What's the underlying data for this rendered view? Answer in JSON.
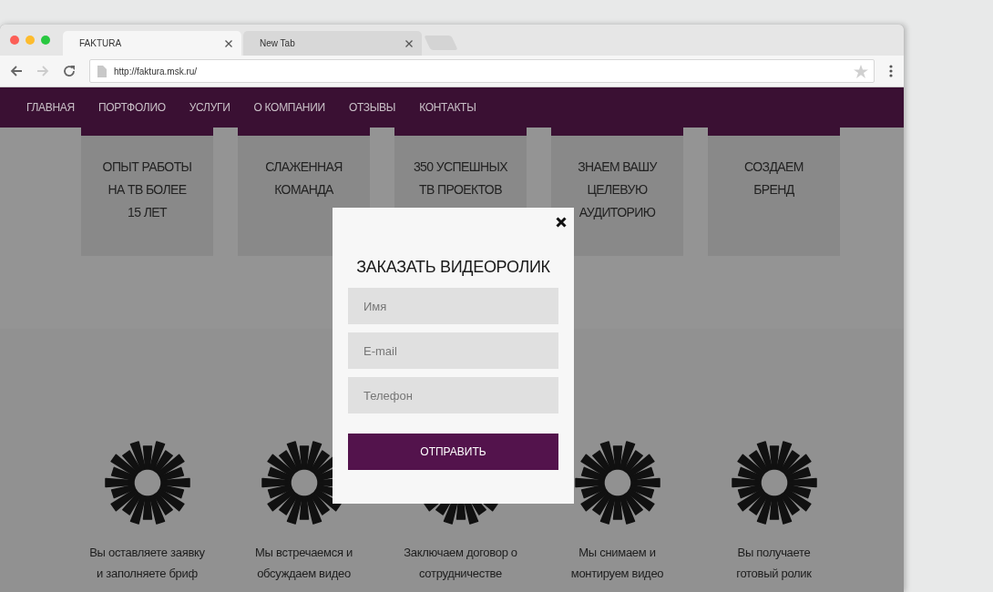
{
  "browser": {
    "tabs": [
      {
        "title": "FAKTURA",
        "selected": true
      },
      {
        "title": "New Tab",
        "selected": false
      }
    ],
    "nav_buttons": [
      {
        "kind": "back",
        "disabled": false
      },
      {
        "kind": "forward",
        "disabled": true
      },
      {
        "kind": "reload",
        "disabled": false
      }
    ],
    "url": "http://faktura.msk.ru/",
    "bookmarked": false
  },
  "site_nav": {
    "items": [
      "ГЛАВНАЯ",
      "ПОРТФОЛИО",
      "УСЛУГИ",
      "О КОМПАНИИ",
      "ОТЗЫВЫ",
      "КОНТАКТЫ"
    ]
  },
  "features": [
    {
      "lines": [
        "ОПЫТ РАБОТЫ",
        "НА ТВ БОЛЕЕ",
        "15 ЛЕТ"
      ]
    },
    {
      "lines": [
        "СЛАЖЕННАЯ",
        "КОМАНДА"
      ]
    },
    {
      "lines": [
        "350 УСПЕШНЫХ",
        "ТВ ПРОЕКТОВ"
      ]
    },
    {
      "lines": [
        "ЗНАЕМ ВАШУ",
        "ЦЕЛЕВУЮ",
        "АУДИТОРИЮ"
      ]
    },
    {
      "lines": [
        "СОЗДАЕМ",
        "БРЕНД"
      ]
    }
  ],
  "steps": [
    {
      "lines": [
        "Вы оставляете заявку",
        "и заполняете бриф"
      ]
    },
    {
      "lines": [
        "Мы встречаемся и",
        "обсуждаем видео"
      ]
    },
    {
      "lines": [
        "Заключаем договор о",
        "сотрудничестве"
      ]
    },
    {
      "lines": [
        "Мы снимаем и",
        "монтируем видео"
      ]
    },
    {
      "lines": [
        "Вы получаете",
        "готовый ролик"
      ]
    }
  ],
  "modal": {
    "title": "ЗАКАЗАТЬ ВИДЕОРОЛИК",
    "fields": [
      {
        "placeholder": "Имя"
      },
      {
        "placeholder": "E-mail"
      },
      {
        "placeholder": "Телефон"
      }
    ],
    "submit": "ОТПРАВИТЬ"
  }
}
